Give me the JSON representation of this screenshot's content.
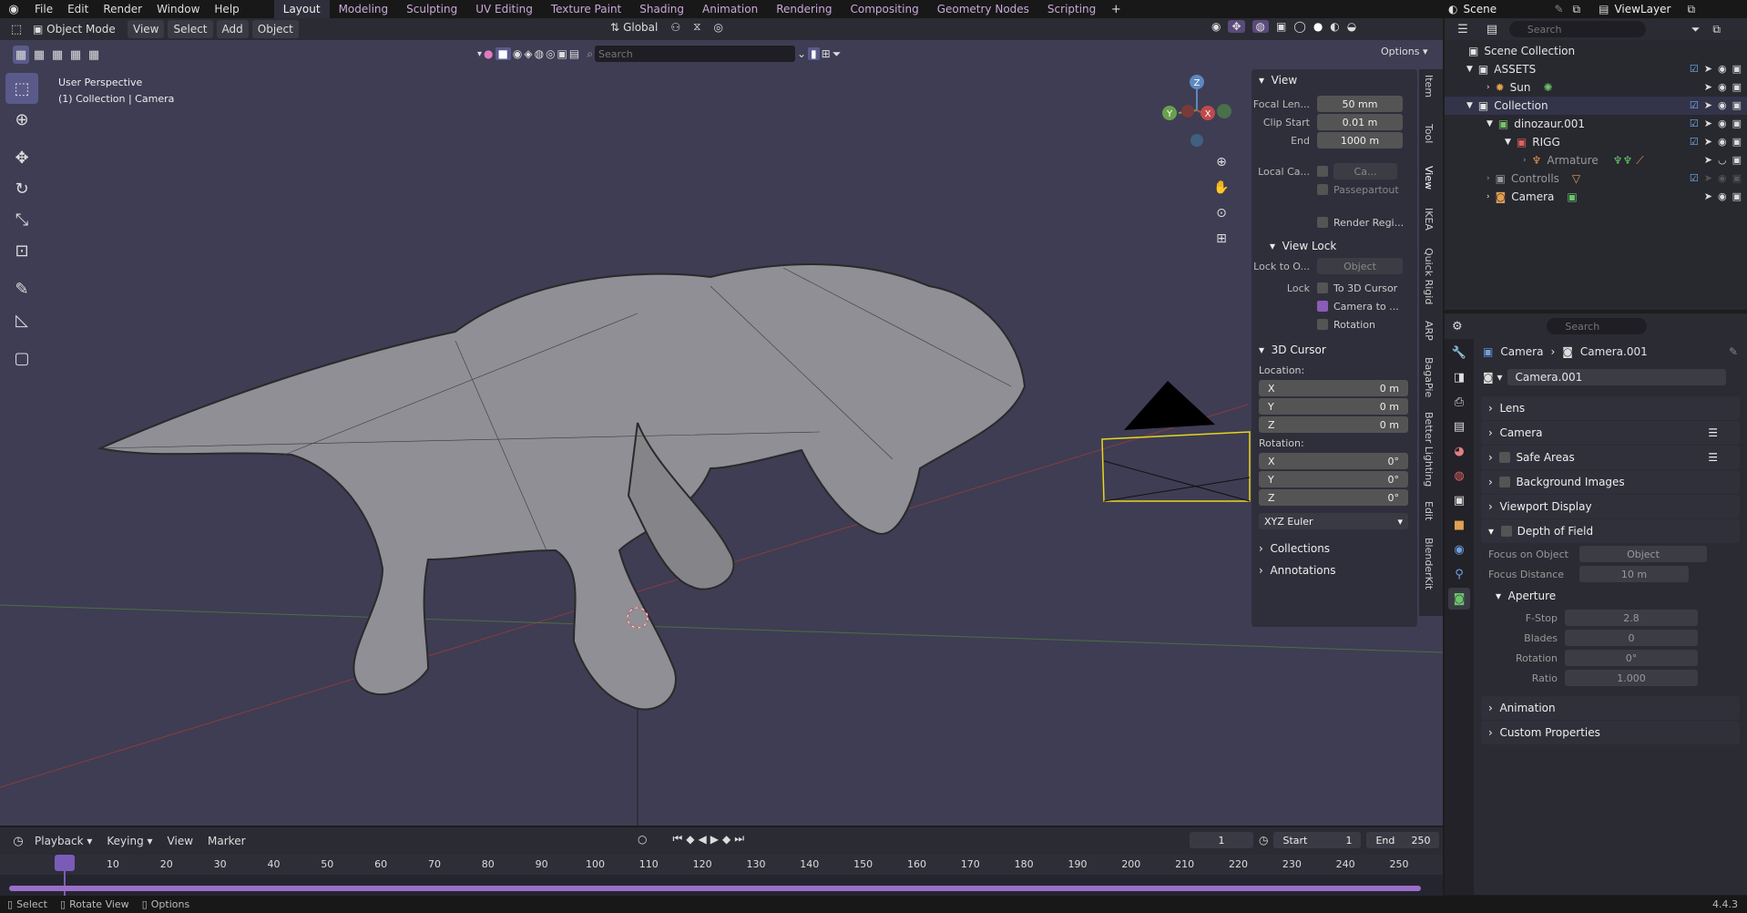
{
  "topbar": {
    "menus": [
      "File",
      "Edit",
      "Render",
      "Window",
      "Help"
    ],
    "workspaces": [
      "Layout",
      "Modeling",
      "Sculpting",
      "UV Editing",
      "Texture Paint",
      "Shading",
      "Animation",
      "Rendering",
      "Compositing",
      "Geometry Nodes",
      "Scripting"
    ],
    "scene": "Scene",
    "view_layer": "ViewLayer"
  },
  "viewport": {
    "mode": "Object Mode",
    "menus": [
      "View",
      "Select",
      "Add",
      "Object"
    ],
    "transform_orientation": "Global",
    "search_placeholder": "Search",
    "options": "Options",
    "overlay_title": "User Perspective",
    "overlay_sub": "(1) Collection | Camera",
    "gizmo": {
      "x": "X",
      "y": "Y",
      "z": "Z"
    }
  },
  "npanel": {
    "view_header": "View",
    "focal_label": "Focal Len...",
    "focal_value": "50 mm",
    "clip_start_label": "Clip Start",
    "clip_start_value": "0.01 m",
    "end_label": "End",
    "end_value": "1000 m",
    "local_cam_label": "Local Ca...",
    "local_cam_value": "Ca...",
    "passepartout": "Passepartout",
    "render_region": "Render Regi...",
    "view_lock_header": "View Lock",
    "lock_to_label": "Lock to O...",
    "lock_to_value": "Object",
    "lock_label": "Lock",
    "to_3d_cursor": "To 3D Cursor",
    "camera_to": "Camera to ...",
    "rotation": "Rotation",
    "cursor_header": "3D Cursor",
    "location_label": "Location:",
    "loc": [
      {
        "axis": "X",
        "value": "0 m"
      },
      {
        "axis": "Y",
        "value": "0 m"
      },
      {
        "axis": "Z",
        "value": "0 m"
      }
    ],
    "rotation_label": "Rotation:",
    "rot": [
      {
        "axis": "X",
        "value": "0°"
      },
      {
        "axis": "Y",
        "value": "0°"
      },
      {
        "axis": "Z",
        "value": "0°"
      }
    ],
    "euler": "XYZ Euler",
    "collections": "Collections",
    "annotations": "Annotations",
    "tabs": [
      "Item",
      "Tool",
      "View",
      "IKEA",
      "Quick Rigid",
      "ARP",
      "BagaPie",
      "Better Lighting",
      "Edit",
      "BlenderKit"
    ]
  },
  "outliner": {
    "search_placeholder": "Search",
    "rows": [
      "Scene Collection",
      "ASSETS",
      "Sun",
      "Collection",
      "dinozaur.001",
      "RIGG",
      "Armature",
      "Controlls",
      "Camera"
    ]
  },
  "properties": {
    "search_placeholder": "Search",
    "breadcrumb_a": "Camera",
    "breadcrumb_b": "Camera.001",
    "datablock": "Camera.001",
    "sections": {
      "lens": "Lens",
      "camera": "Camera",
      "safe_areas": "Safe Areas",
      "bg_images": "Background Images",
      "viewport_display": "Viewport Display",
      "dof": "Depth of Field",
      "focus_obj_label": "Focus on Object",
      "focus_obj_value": "Object",
      "focus_dist_label": "Focus Distance",
      "focus_dist_value": "10 m",
      "aperture": "Aperture",
      "fstop_label": "F-Stop",
      "fstop_value": "2.8",
      "blades_label": "Blades",
      "blades_value": "0",
      "rotation_label": "Rotation",
      "rotation_value": "0°",
      "ratio_label": "Ratio",
      "ratio_value": "1.000",
      "animation": "Animation",
      "custom_props": "Custom Properties"
    }
  },
  "timeline": {
    "menus": [
      "Playback",
      "Keying",
      "View",
      "Marker"
    ],
    "current_frame": "1",
    "start_label": "Start",
    "start_value": "1",
    "end_label": "End",
    "end_value": "250",
    "ticks": [
      "1",
      "10",
      "20",
      "30",
      "40",
      "50",
      "60",
      "70",
      "80",
      "90",
      "100",
      "110",
      "120",
      "130",
      "140",
      "150",
      "160",
      "170",
      "180",
      "190",
      "200",
      "210",
      "220",
      "230",
      "240",
      "250"
    ]
  },
  "statusbar": {
    "select": "Select",
    "rotate_view": "Rotate View",
    "options": "Options",
    "version": "4.4.3"
  },
  "colors": {
    "accent": "#8a5cb8",
    "viewport_bg": "#3e3d54",
    "camera_outline": "#e8d61c"
  }
}
